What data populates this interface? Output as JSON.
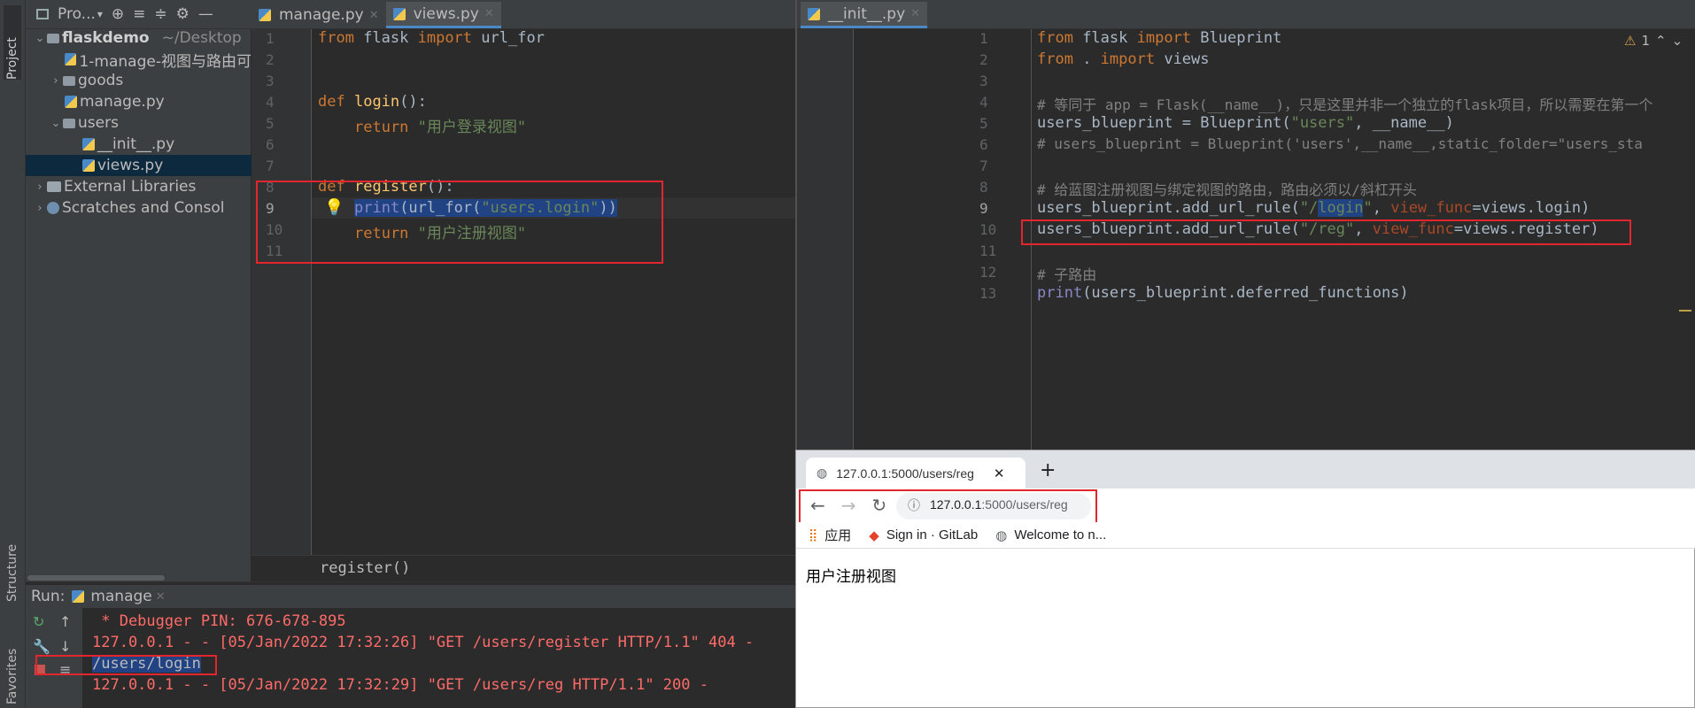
{
  "sidebar": {
    "project_tab": "Project",
    "structure_tab": "Structure",
    "favorites_tab": "Favorites"
  },
  "project_panel": {
    "title": "Pro...",
    "root": "flaskdemo",
    "root_path": "~/Desktop",
    "items": [
      {
        "label": "1-manage-视图与路由可"
      },
      {
        "label": "goods"
      },
      {
        "label": "manage.py"
      },
      {
        "label": "users"
      },
      {
        "label": "__init__.py"
      },
      {
        "label": "views.py"
      },
      {
        "label": "External Libraries"
      },
      {
        "label": "Scratches and Consol"
      }
    ]
  },
  "left_editor": {
    "tabs": [
      "manage.py",
      "views.py"
    ],
    "breadcrumb": "register()",
    "line_numbers": [
      "1",
      "2",
      "3",
      "4",
      "5",
      "6",
      "7",
      "8",
      "9",
      "10",
      "11"
    ],
    "lines": {
      "l1_kw1": "from",
      "l1_mod": " flask ",
      "l1_kw2": "import",
      "l1_name": " url_for",
      "l4_kw": "def",
      "l4_fn": "login",
      "l4_rest": "():",
      "l5_kw": "return",
      "l5_str": "\"用户登录视图\"",
      "l8_kw": "def",
      "l8_fn": "register",
      "l8_rest": "():",
      "l9_print": "print",
      "l9_a": "(url_for(",
      "l9_str": "\"users.login\"",
      "l9_b": "))",
      "l10_kw": "return",
      "l10_str": "\"用户注册视图\""
    }
  },
  "right_editor": {
    "tabs": [
      "__init__.py"
    ],
    "warning_count": "1",
    "line_numbers": [
      "1",
      "2",
      "3",
      "4",
      "5",
      "6",
      "7",
      "8",
      "9",
      "10",
      "11",
      "12",
      "13"
    ],
    "lines": {
      "l1_kw1": "from",
      "l1_mod": " flask ",
      "l1_kw2": "import",
      "l1_name": " Blueprint",
      "l2_kw1": "from",
      "l2_mod": " . ",
      "l2_kw2": "import",
      "l2_name": " views",
      "l4_cmt": "# 等同于 app = Flask(__name__)，只是这里并非一个独立的flask项目，所以需要在第一个",
      "l5_a": "users_blueprint = Blueprint(",
      "l5_str": "\"users\"",
      "l5_b": ", __name__)",
      "l6_cmt": "# users_blueprint = Blueprint('users',__name__,static_folder=\"users_sta",
      "l8_cmt": "# 给蓝图注册视图与绑定视图的路由，路由必须以/斜杠开头",
      "l9_a": "users_blueprint.add_url_rule(",
      "l9_str1": "\"/",
      "l9_hl": "login",
      "l9_str2": "\"",
      "l9_b": ", ",
      "l9_attr": "view_func",
      "l9_c": "=views.login)",
      "l10_a": "users_blueprint.add_url_rule(",
      "l10_str": "\"/reg\"",
      "l10_b": ", ",
      "l10_attr": "view_func",
      "l10_c": "=views.register)",
      "l12_cmt": "# 子路由",
      "l13_print": "print",
      "l13_rest": "(users_blueprint.deferred_functions)"
    }
  },
  "run_panel": {
    "label": "Run:",
    "config": "manage",
    "output": [
      " * Debugger PIN: 676-678-895",
      "127.0.0.1 - - [05/Jan/2022 17:32:26] \"GET /users/register HTTP/1.1\" 404 -",
      "/users/login",
      "127.0.0.1 - - [05/Jan/2022 17:32:29] \"GET /users/reg HTTP/1.1\" 200 -"
    ]
  },
  "browser": {
    "tab_title": "127.0.0.1:5000/users/reg",
    "url_host": "127.0.0.1",
    "url_rest": ":5000/users/reg",
    "bookmarks": [
      "应用",
      "Sign in · GitLab",
      "Welcome to n..."
    ],
    "page_text": "用户注册视图"
  }
}
